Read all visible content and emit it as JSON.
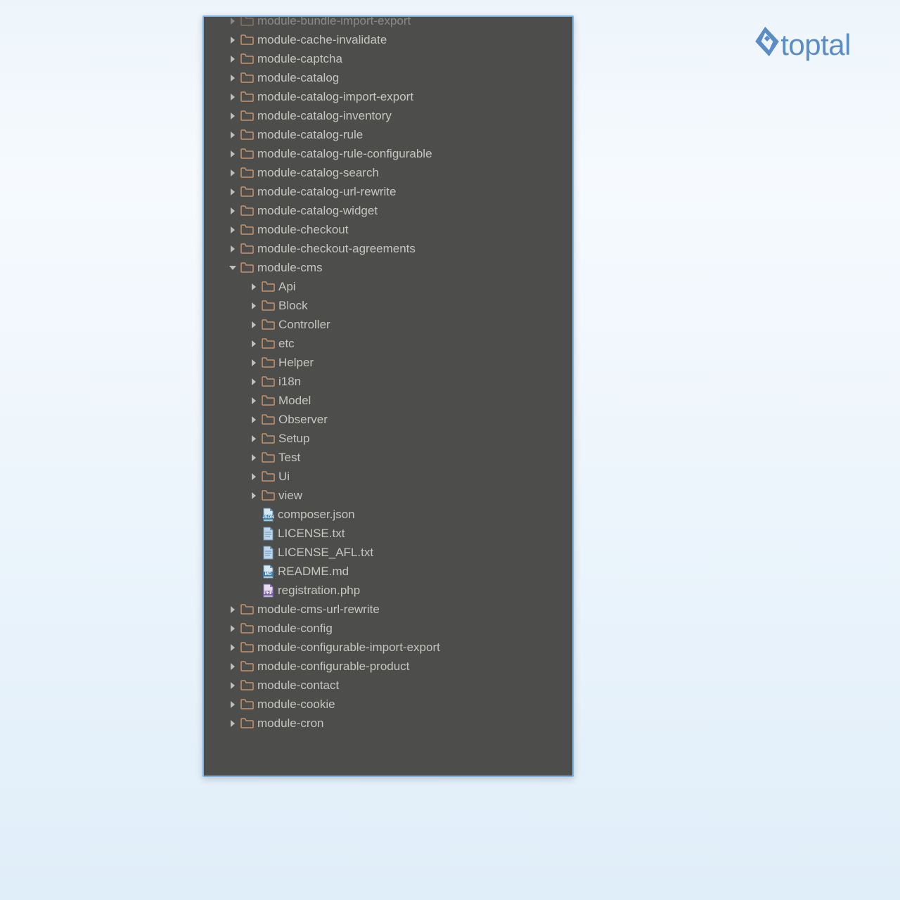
{
  "brand": {
    "name": "toptal"
  },
  "colors": {
    "panel_bg": "#4d4e4c",
    "panel_border": "#7ab2e4",
    "folder": "#c6946b",
    "text": "#c5c5c0",
    "logo": "#5a8cc8"
  },
  "tree": {
    "cutoff_top": {
      "label": "module-bundle-import-export"
    },
    "top_modules": [
      {
        "label": "module-cache-invalidate"
      },
      {
        "label": "module-captcha"
      },
      {
        "label": "module-catalog"
      },
      {
        "label": "module-catalog-import-export"
      },
      {
        "label": "module-catalog-inventory"
      },
      {
        "label": "module-catalog-rule"
      },
      {
        "label": "module-catalog-rule-configurable"
      },
      {
        "label": "module-catalog-search"
      },
      {
        "label": "module-catalog-url-rewrite"
      },
      {
        "label": "module-catalog-widget"
      },
      {
        "label": "module-checkout"
      },
      {
        "label": "module-checkout-agreements"
      }
    ],
    "expanded": {
      "label": "module-cms",
      "folders": [
        {
          "label": "Api"
        },
        {
          "label": "Block"
        },
        {
          "label": "Controller"
        },
        {
          "label": "etc"
        },
        {
          "label": "Helper"
        },
        {
          "label": "i18n"
        },
        {
          "label": "Model"
        },
        {
          "label": "Observer"
        },
        {
          "label": "Setup"
        },
        {
          "label": "Test"
        },
        {
          "label": "Ui"
        },
        {
          "label": "view"
        }
      ],
      "files": [
        {
          "label": "composer.json",
          "type": "json"
        },
        {
          "label": "LICENSE.txt",
          "type": "txt"
        },
        {
          "label": "LICENSE_AFL.txt",
          "type": "txt"
        },
        {
          "label": "README.md",
          "type": "md"
        },
        {
          "label": "registration.php",
          "type": "php"
        }
      ]
    },
    "bottom_modules": [
      {
        "label": "module-cms-url-rewrite"
      },
      {
        "label": "module-config"
      },
      {
        "label": "module-configurable-import-export"
      },
      {
        "label": "module-configurable-product"
      },
      {
        "label": "module-contact"
      },
      {
        "label": "module-cookie"
      },
      {
        "label": "module-cron"
      }
    ]
  }
}
